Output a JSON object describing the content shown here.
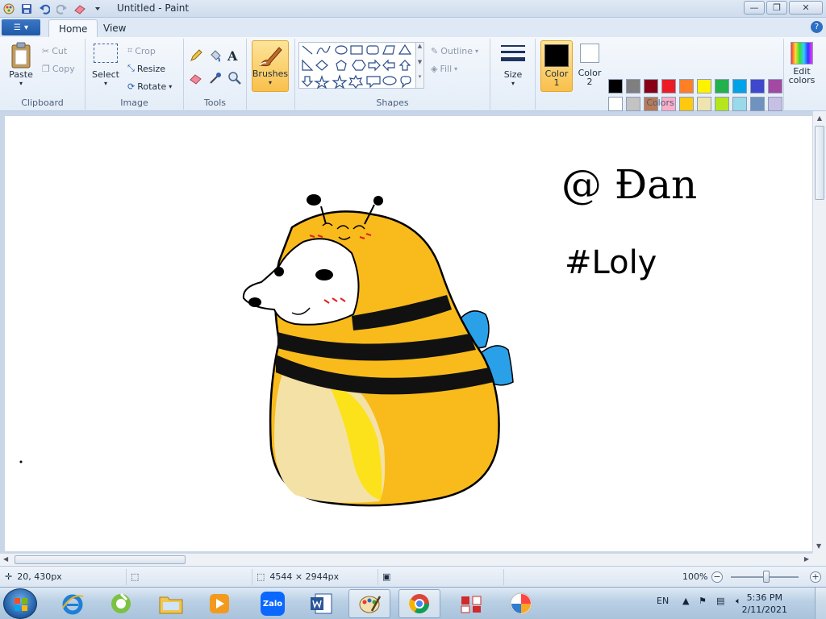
{
  "window": {
    "title": "Untitled - Paint",
    "controls": {
      "minimize": "—",
      "maximize": "❐",
      "close": "✕"
    }
  },
  "tabs": [
    {
      "label": "Home",
      "active": true
    },
    {
      "label": "View",
      "active": false
    }
  ],
  "help_label": "?",
  "ribbon": {
    "clipboard": {
      "label": "Clipboard",
      "paste": "Paste",
      "cut": "Cut",
      "copy": "Copy"
    },
    "image": {
      "label": "Image",
      "select": "Select",
      "crop": "Crop",
      "resize": "Resize",
      "rotate": "Rotate"
    },
    "tools": {
      "label": "Tools"
    },
    "brushes": {
      "label": "Brushes"
    },
    "shapes": {
      "label": "Shapes",
      "outline": "Outline",
      "fill": "Fill"
    },
    "size": {
      "label": "Size"
    },
    "color1": {
      "line1": "Color",
      "line2": "1",
      "value": "#000000"
    },
    "color2": {
      "line1": "Color",
      "line2": "2",
      "value": "#ffffff"
    },
    "colors": {
      "label": "Colors",
      "row1": [
        "#000000",
        "#7f7f7f",
        "#880015",
        "#ed1c24",
        "#ff7f27",
        "#fff200",
        "#22b14c",
        "#00a2e8",
        "#3f48cc",
        "#a349a4"
      ],
      "row2": [
        "#ffffff",
        "#c3c3c3",
        "#b97a57",
        "#ffaec9",
        "#ffc90e",
        "#efe4b0",
        "#b5e61d",
        "#99d9ea",
        "#7092be",
        "#c8bfe7"
      ]
    },
    "edit_colors": {
      "line1": "Edit",
      "line2": "colors"
    }
  },
  "canvas": {
    "text_line1": "@ Đan",
    "text_line2": "#Loly"
  },
  "status": {
    "cursor_pos": "20, 430px",
    "image_size": "4544 × 2944px",
    "zoom": "100%"
  },
  "taskbar": {
    "zalo_label": "Zalo",
    "language": "EN",
    "time": "5:36 PM",
    "date": "2/11/2021"
  }
}
